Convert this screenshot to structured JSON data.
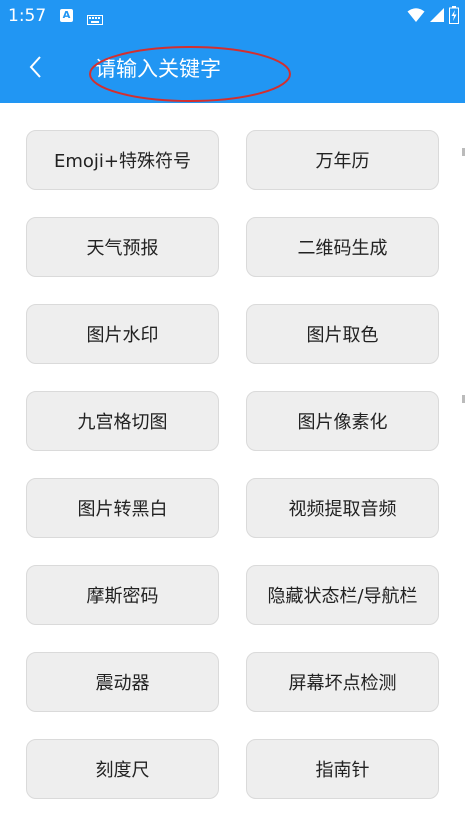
{
  "status_bar": {
    "time": "1:57",
    "notification_letter": "A"
  },
  "header": {
    "search_text": "请输入关键字"
  },
  "tools": [
    {
      "label": "Emoji+特殊符号"
    },
    {
      "label": "万年历"
    },
    {
      "label": "天气预报"
    },
    {
      "label": "二维码生成"
    },
    {
      "label": "图片水印"
    },
    {
      "label": "图片取色"
    },
    {
      "label": "九宫格切图"
    },
    {
      "label": "图片像素化"
    },
    {
      "label": "图片转黑白"
    },
    {
      "label": "视频提取音频"
    },
    {
      "label": "摩斯密码"
    },
    {
      "label": "隐藏状态栏/导航栏"
    },
    {
      "label": "震动器"
    },
    {
      "label": "屏幕坏点检测"
    },
    {
      "label": "刻度尺"
    },
    {
      "label": "指南针"
    }
  ],
  "colors": {
    "header": "#2196f3",
    "annotation": "#d32f2f",
    "button_bg": "#eeeeee"
  }
}
